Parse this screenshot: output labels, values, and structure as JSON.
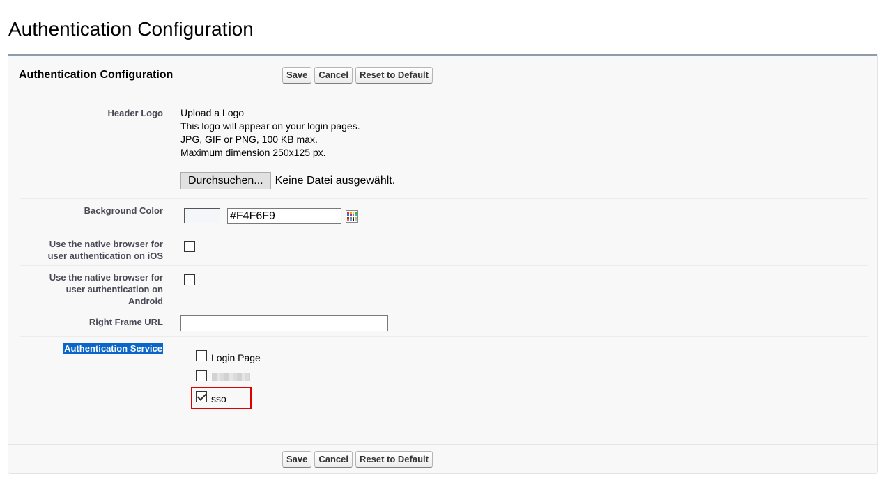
{
  "page": {
    "title": "Authentication Configuration"
  },
  "panel": {
    "title": "Authentication Configuration",
    "buttons": {
      "save": "Save",
      "cancel": "Cancel",
      "reset": "Reset to Default"
    }
  },
  "fields": {
    "header_logo": {
      "label": "Header Logo",
      "help": [
        "Upload a Logo",
        "This logo will appear on your login pages.",
        "JPG, GIF or PNG, 100 KB max.",
        "Maximum dimension 250x125 px."
      ],
      "browse_label": "Durchsuchen...",
      "file_status": "Keine Datei ausgewählt."
    },
    "background_color": {
      "label": "Background Color",
      "value": "#F4F6F9",
      "swatch_color": "#F4F6F9"
    },
    "native_ios": {
      "label_lines": [
        "Use the native browser for",
        "user authentication on iOS"
      ],
      "checked": false
    },
    "native_android": {
      "label_lines": [
        "Use the native browser for",
        "user authentication on",
        "Android"
      ],
      "checked": false
    },
    "right_frame_url": {
      "label": "Right Frame URL",
      "value": ""
    },
    "auth_service": {
      "label": "Authentication Service",
      "options": [
        {
          "label": "Login Page",
          "checked": false
        },
        {
          "label": "",
          "checked": false,
          "redacted": true
        },
        {
          "label": "sso",
          "checked": true
        }
      ]
    }
  },
  "colors": {
    "highlight": "#e00000",
    "selection": "#0a66c8",
    "panel_border_top": "#8e9dab"
  }
}
